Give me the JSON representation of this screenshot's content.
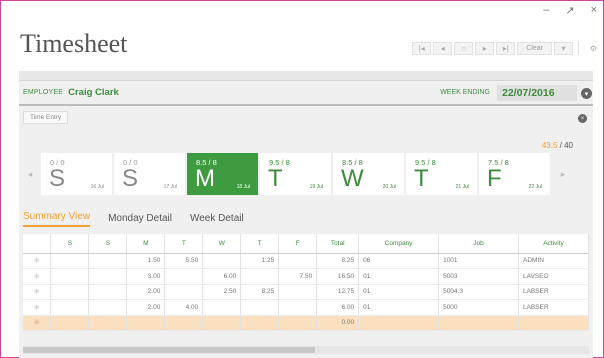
{
  "window": {
    "minimize": "–",
    "maximize": "↗",
    "close": "×"
  },
  "app": {
    "title": "Timesheet"
  },
  "toolbar": {
    "first": "|◂",
    "prev": "◂",
    "refresh": "○",
    "next": "▸",
    "last": "▸|",
    "clear": "Clear",
    "filter": "▾",
    "settings": "⚙"
  },
  "employee": {
    "label": "EMPLOYEE",
    "name": "Craig Clark"
  },
  "week_ending": {
    "label": "WEEK ENDING",
    "value": "22/07/2016"
  },
  "time_entry_tab": "Time Entry",
  "totals": {
    "current": "43.5",
    "target": " / 40"
  },
  "days": [
    {
      "hours": "0 / 0",
      "letter": "S",
      "date": "16 Jul",
      "state": "off"
    },
    {
      "hours": "0 / 0",
      "letter": "S",
      "date": "17 Jul",
      "state": "off"
    },
    {
      "hours": "8.5 / 8",
      "letter": "M",
      "date": "18 Jul",
      "state": "sel"
    },
    {
      "hours": "9.5 / 8",
      "letter": "T",
      "date": "19 Jul",
      "state": "on"
    },
    {
      "hours": "8.5 / 8",
      "letter": "W",
      "date": "20 Jul",
      "state": "on"
    },
    {
      "hours": "9.5 / 8",
      "letter": "T",
      "date": "21 Jul",
      "state": "on"
    },
    {
      "hours": "7.5 / 8",
      "letter": "F",
      "date": "22 Jul",
      "state": "on"
    }
  ],
  "tabs": [
    "Summary View",
    "Monday Detail",
    "Week Detail"
  ],
  "grid": {
    "headers": [
      "",
      "S",
      "S",
      "M",
      "T",
      "W",
      "T",
      "F",
      "Total",
      "Company",
      "Job",
      "Activity"
    ],
    "rows": [
      [
        "",
        "",
        "1.50",
        "5.50",
        "",
        "1.25",
        "",
        "8.25",
        "06",
        "1001",
        "ADMIN"
      ],
      [
        "",
        "",
        "3.00",
        "",
        "6.00",
        "",
        "7.50",
        "16.50",
        "01",
        "5003",
        "LAVSEO"
      ],
      [
        "",
        "",
        "2.00",
        "",
        "2.50",
        "8.25",
        "",
        "12.75",
        "01",
        "5004.3",
        "LABSER"
      ],
      [
        "",
        "",
        "2.00",
        "4.00",
        "",
        "",
        "",
        "6.00",
        "01",
        "5000",
        "LABSER"
      ],
      [
        "",
        "",
        "",
        "",
        "",
        "",
        "",
        "0.00",
        "",
        "",
        ""
      ]
    ]
  },
  "colors": {
    "accent": "#3f9b3f",
    "highlight": "#f0a030",
    "window_border": "#c74aa0"
  }
}
